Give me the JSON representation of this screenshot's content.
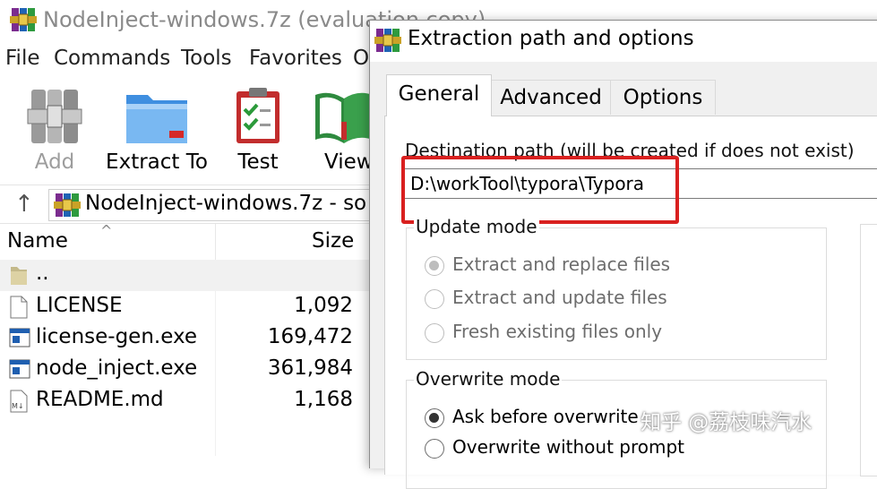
{
  "archive_window": {
    "title": "NodeInject-windows.7z (evaluation copy)",
    "menu": [
      "File",
      "Commands",
      "Tools",
      "Favorites",
      "O"
    ],
    "toolbar": [
      {
        "label": "Add",
        "icon": "add-archive-icon",
        "disabled": true
      },
      {
        "label": "Extract To",
        "icon": "extract-folder-icon"
      },
      {
        "label": "Test",
        "icon": "test-clipboard-icon"
      },
      {
        "label": "View",
        "icon": "view-book-icon"
      }
    ],
    "address": "NodeInject-windows.7z - so",
    "columns": {
      "name": "Name",
      "size": "Size"
    },
    "files": [
      {
        "name": "..",
        "size": "",
        "icon": "folder-icon"
      },
      {
        "name": "LICENSE",
        "size": "1,092",
        "icon": "file-icon"
      },
      {
        "name": "license-gen.exe",
        "size": "169,472",
        "icon": "exe-icon"
      },
      {
        "name": "node_inject.exe",
        "size": "361,984",
        "icon": "exe-icon"
      },
      {
        "name": "README.md",
        "size": "1,168",
        "icon": "markdown-icon"
      }
    ]
  },
  "dialog": {
    "title": "Extraction path and options",
    "tabs": [
      "General",
      "Advanced",
      "Options"
    ],
    "active_tab": "General",
    "destination_label": "Destination path (will be created if does not exist)",
    "destination_value": "D:\\workTool\\typora\\Typora",
    "update_mode": {
      "label": "Update mode",
      "options": [
        "Extract and replace files",
        "Extract and update files",
        "Fresh existing files only"
      ],
      "selected": "Extract and replace files"
    },
    "overwrite_mode": {
      "label": "Overwrite mode",
      "options": [
        "Ask before overwrite",
        "Overwrite without prompt"
      ],
      "selected": "Ask before overwrite"
    }
  },
  "watermark": "知乎 @荔枝味汽水",
  "colors": {
    "highlight": "#d9201f"
  }
}
